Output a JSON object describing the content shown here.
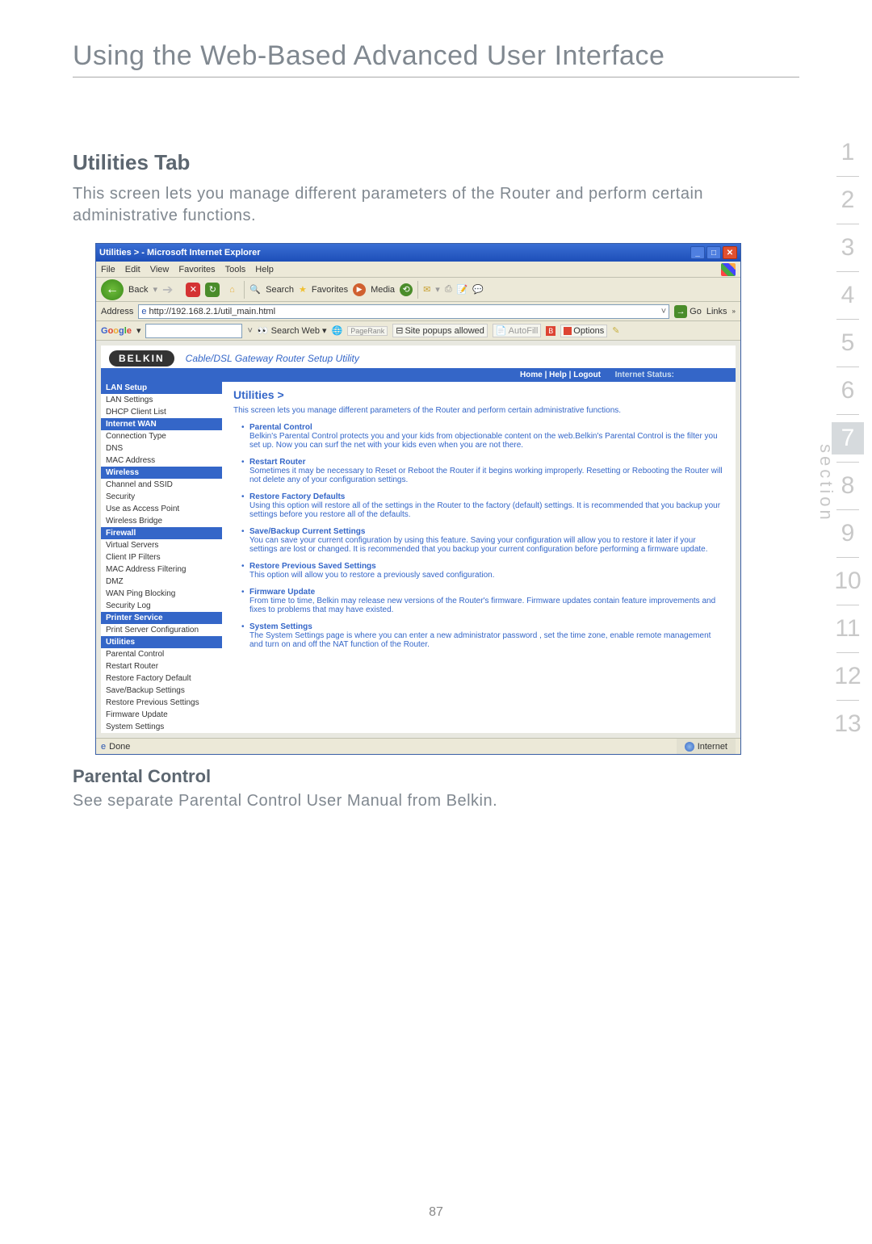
{
  "doc": {
    "main_title": "Using the Web-Based Advanced User Interface",
    "section_heading": "Utilities Tab",
    "intro_text": "This screen lets you manage different parameters of the Router and perform certain administrative functions.",
    "sub_heading": "Parental Control",
    "sub_text": "See separate Parental Control User Manual from Belkin.",
    "page_number": "87",
    "section_word": "section"
  },
  "side_tabs": [
    "1",
    "2",
    "3",
    "4",
    "5",
    "6",
    "7",
    "8",
    "9",
    "10",
    "11",
    "12",
    "13"
  ],
  "active_tab_index": 6,
  "ie": {
    "title": "Utilities > - Microsoft Internet Explorer",
    "menu": [
      "File",
      "Edit",
      "View",
      "Favorites",
      "Tools",
      "Help"
    ],
    "back": "Back",
    "search": "Search",
    "favorites": "Favorites",
    "media": "Media",
    "address_label": "Address",
    "address_value": "http://192.168.2.1/util_main.html",
    "go": "Go",
    "links": "Links",
    "done": "Done",
    "zone": "Internet"
  },
  "google": {
    "search_web": "Search Web",
    "pagerank": "PageRank",
    "popups": "Site popups allowed",
    "autofill": "AutoFill",
    "b": "B",
    "options": "Options"
  },
  "belkin": {
    "logo": "BELKIN",
    "tagline": "Cable/DSL Gateway Router Setup Utility",
    "topbar_links": "Home | Help | Logout",
    "status_label": "Internet Status:",
    "sidebar": {
      "g1": "LAN Setup",
      "g1_items": [
        "LAN Settings",
        "DHCP Client List"
      ],
      "g2": "Internet WAN",
      "g2_items": [
        "Connection Type",
        "DNS",
        "MAC Address"
      ],
      "g3": "Wireless",
      "g3_items": [
        "Channel and SSID",
        "Security",
        "Use as Access Point",
        "Wireless Bridge"
      ],
      "g4": "Firewall",
      "g4_items": [
        "Virtual Servers",
        "Client IP Filters",
        "MAC Address Filtering",
        "DMZ",
        "WAN Ping Blocking",
        "Security Log"
      ],
      "g5": "Printer Service",
      "g5_items": [
        "Print Server Configuration"
      ],
      "g6": "Utilities",
      "g6_items": [
        "Parental Control",
        "Restart Router",
        "Restore Factory Default",
        "Save/Backup Settings",
        "Restore Previous Settings",
        "Firmware Update",
        "System Settings"
      ]
    },
    "main": {
      "title": "Utilities >",
      "intro": "This screen lets you manage different parameters of the Router and perform certain administrative functions.",
      "items": [
        {
          "t": "Parental Control",
          "d": "Belkin's Parental Control protects you and your kids from objectionable content on the web.Belkin's Parental Control is the filter you set up. Now you can surf the net with your kids even when you are not there."
        },
        {
          "t": "Restart Router",
          "d": "Sometimes it may be necessary to Reset or Reboot the Router if it begins working improperly. Resetting or Rebooting the Router will not delete any of your configuration settings."
        },
        {
          "t": "Restore Factory Defaults",
          "d": "Using this option will restore all of the settings in the Router to the factory (default) settings. It is recommended that you backup your settings before you restore all of the defaults."
        },
        {
          "t": "Save/Backup Current Settings",
          "d": "You can save your current configuration by using this feature. Saving your configuration will allow you to restore it later if your settings are lost or changed. It is recommended that you backup your current configuration before performing a firmware update."
        },
        {
          "t": "Restore Previous Saved Settings",
          "d": "This option will allow you to restore a previously saved configuration."
        },
        {
          "t": "Firmware Update",
          "d": "From time to time, Belkin may release new versions of the Router's firmware. Firmware updates contain feature improvements and fixes to problems that may have existed."
        },
        {
          "t": "System Settings",
          "d": "The System Settings page is where you can enter a new administrator password , set the time zone, enable remote management and turn on and off the NAT function of the Router."
        }
      ]
    }
  }
}
